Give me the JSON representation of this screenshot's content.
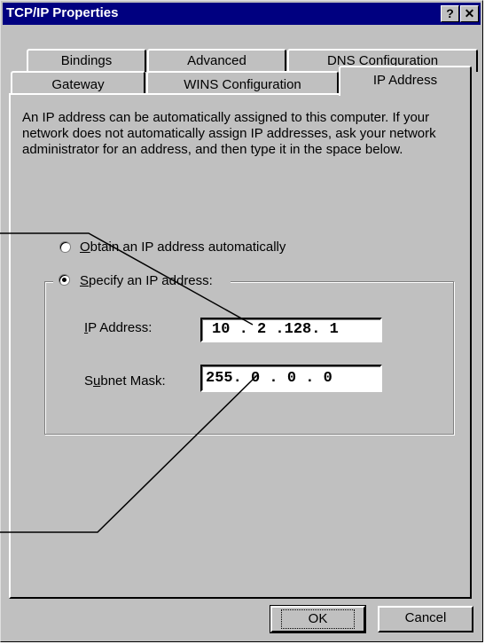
{
  "window": {
    "title": "TCP/IP Properties",
    "help_button": "?",
    "close_button": "✕"
  },
  "tabs": {
    "back_row": [
      "Bindings",
      "Advanced",
      "DNS Configuration"
    ],
    "front_row": [
      "Gateway",
      "WINS Configuration",
      "IP Address"
    ],
    "active": "IP Address"
  },
  "description": "An IP address can be automatically assigned to this computer. If your network does not automatically assign IP addresses, ask your network administrator for an address, and then type it in the space below.",
  "options": {
    "obtain_label_first": "O",
    "obtain_label_rest": "btain an IP address automatically",
    "obtain_selected": false,
    "specify_label_first": "S",
    "specify_label_rest": "pecify an IP address:",
    "specify_selected": true
  },
  "ip_address": {
    "label_first": "I",
    "label_rest": "P Address:",
    "value": "10 . 2 .128. 1"
  },
  "subnet_mask": {
    "label_prefix": "S",
    "label_under": "u",
    "label_rest": "bnet Mask:",
    "value": "255. 0 . 0 . 0"
  },
  "buttons": {
    "ok": "OK",
    "cancel": "Cancel"
  }
}
